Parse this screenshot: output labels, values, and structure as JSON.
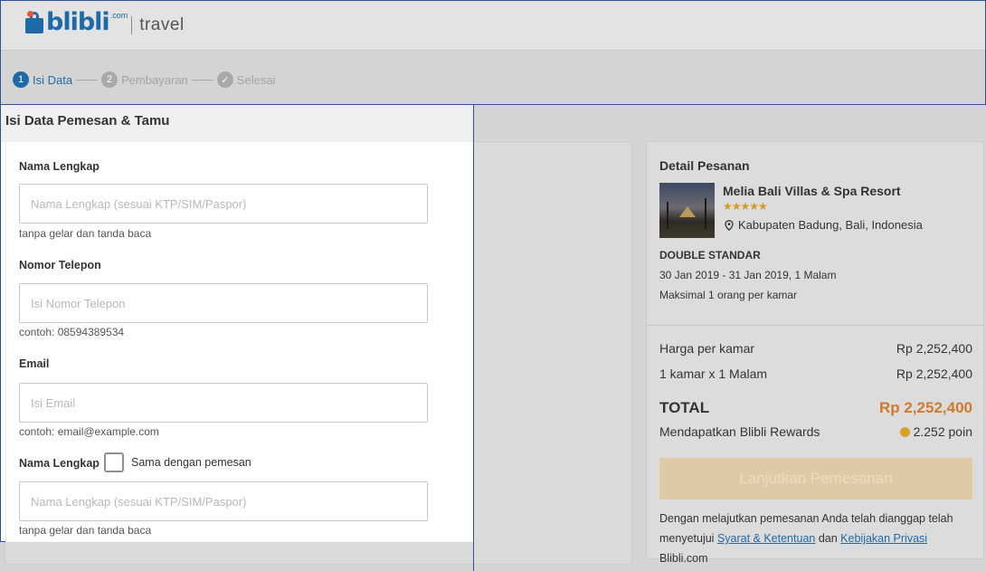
{
  "header": {
    "brand": "blibli",
    "brand_suffix": ".com",
    "product": "travel"
  },
  "stepper": {
    "steps": [
      {
        "number": "1",
        "label": "Isi Data",
        "state": "active"
      },
      {
        "number": "2",
        "label": "Pembayaran",
        "state": "inactive"
      },
      {
        "number": "✓",
        "label": "Selesai",
        "state": "inactive"
      }
    ]
  },
  "form": {
    "title": "Isi Data Pemesan & Tamu",
    "fields": [
      {
        "label": "Nama Lengkap",
        "placeholder": "Nama Lengkap (sesuai KTP/SIM/Paspor)",
        "value": "",
        "hint": "tanpa gelar dan tanda baca"
      },
      {
        "label": "Nomor Telepon",
        "placeholder": "Isi Nomor Telepon",
        "value": "",
        "hint": "contoh: 08594389534"
      },
      {
        "label": "Email",
        "placeholder": "Isi Email",
        "value": "",
        "hint": "contoh: email@example.com"
      },
      {
        "label": "Nama Lengkap",
        "placeholder": "Nama Lengkap (sesuai KTP/SIM/Paspor)",
        "value": "",
        "hint": "tanpa gelar dan tanda baca"
      }
    ],
    "same_as_booker_label": "Sama dengan pemesan",
    "same_as_booker_checked": false
  },
  "detail": {
    "title": "Detail Pesanan",
    "hotel_name": "Melia Bali Villas & Spa Resort",
    "stars": "★★★★★",
    "star_rating": 5,
    "location": "Kabupaten Badung, Bali, Indonesia",
    "room_type": "DOUBLE STANDAR",
    "dates": "30 Jan 2019 - 31 Jan 2019, 1 Malam",
    "capacity": "Maksimal 1 orang per kamar",
    "price_per_room_label": "Harga per kamar",
    "price_per_room_value": "Rp 2,252,400",
    "rooms_nights_label": "1 kamar x 1 Malam",
    "rooms_nights_value": "Rp 2,252,400",
    "total_label": "TOTAL",
    "total_value": "Rp 2,252,400",
    "rewards_label": "Mendapatkan Blibli Rewards",
    "rewards_value": "2.252 poin",
    "cta_label": "Lanjutkan Pemesanan",
    "terms_prefix": "Dengan melajutkan pemesanan Anda telah dianggap telah menyetujui",
    "terms_link_1": "Syarat & Ketentuan",
    "terms_and": "dan",
    "terms_link_2": "Kebijakan Privasi",
    "terms_suffix": "Blibli.com"
  },
  "colors": {
    "brand_blue": "#1e6aa8",
    "total_orange": "#cf7a2c",
    "star_gold": "#d59a1c"
  }
}
